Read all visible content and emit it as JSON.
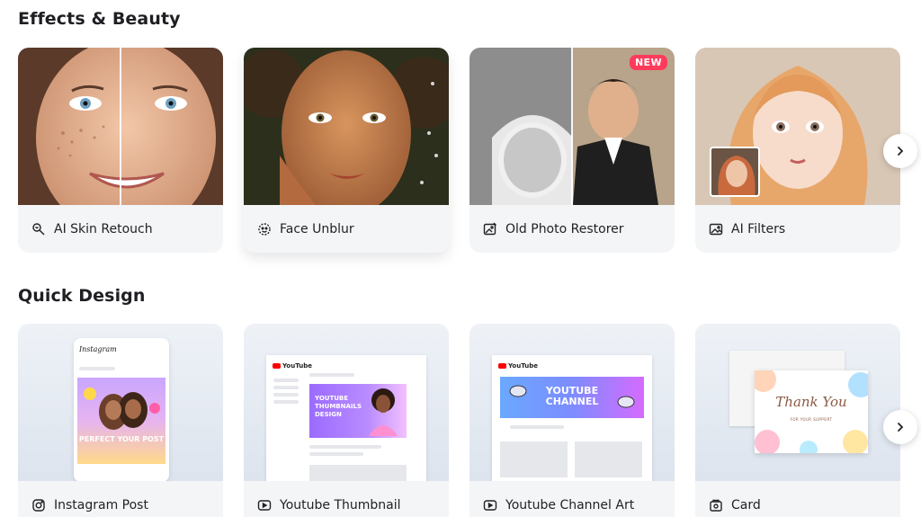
{
  "sections": {
    "effects_title": "Effects & Beauty",
    "quick_title": "Quick Design"
  },
  "effects": [
    {
      "label": "AI Skin Retouch",
      "icon": "skin-retouch-icon"
    },
    {
      "label": "Face Unblur",
      "icon": "face-unblur-icon"
    },
    {
      "label": "Old Photo Restorer",
      "icon": "photo-restore-icon",
      "badge": "NEW"
    },
    {
      "label": "AI Filters",
      "icon": "filters-icon"
    }
  ],
  "quick": [
    {
      "label": "Instagram Post",
      "icon": "instagram-icon",
      "mock_header": "Instagram",
      "mock_text": "PERFECT YOUR POST"
    },
    {
      "label": "Youtube Thumbnail",
      "icon": "youtube-play-icon",
      "mock_header": "YouTube",
      "mock_text": "YOUTUBE THUMBNAILS DESIGN"
    },
    {
      "label": "Youtube Channel Art",
      "icon": "youtube-play-icon",
      "mock_header": "YouTube",
      "mock_text": "YOUTUBE CHANNEL"
    },
    {
      "label": "Card",
      "icon": "card-icon",
      "mock_text": "Thank You",
      "mock_sub": "FOR YOUR SUPPORT"
    }
  ],
  "colors": {
    "accent_new": "#ff3b5c",
    "caption_bg": "#f4f5f7",
    "youtube_red": "#ff0000"
  }
}
